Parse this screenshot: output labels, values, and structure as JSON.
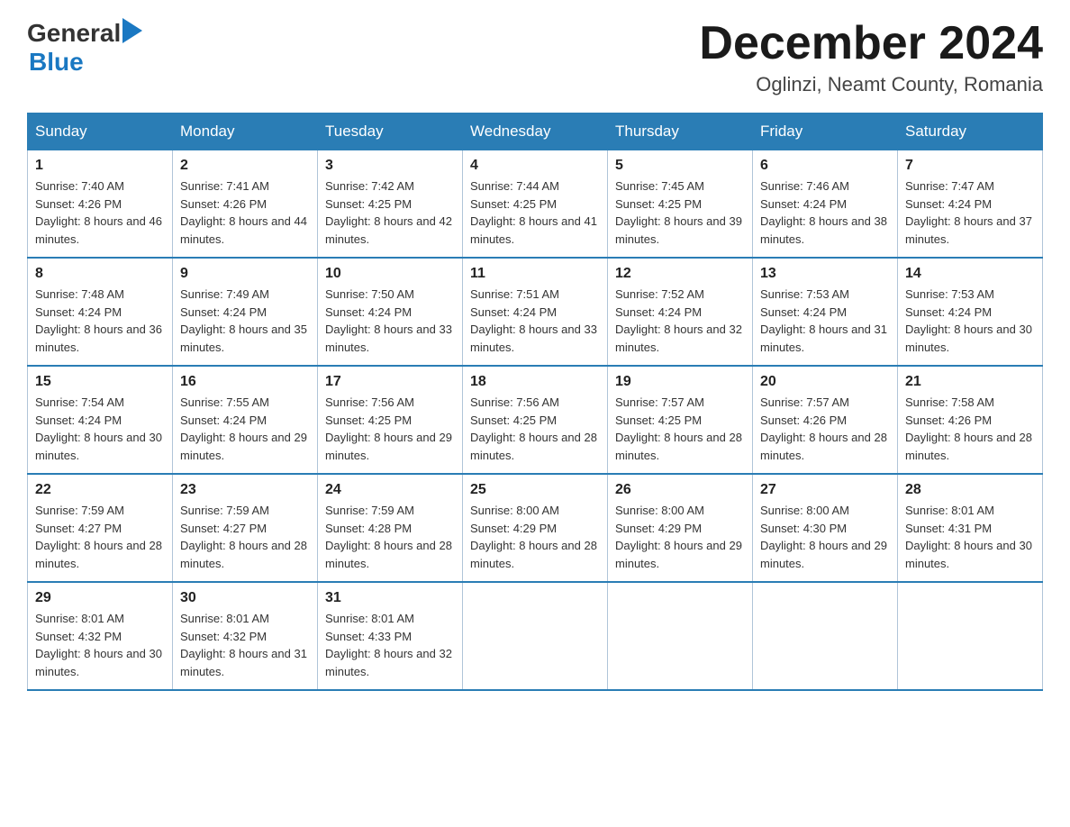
{
  "header": {
    "logo": {
      "general": "General",
      "blue": "Blue"
    },
    "title": "December 2024",
    "location": "Oglinzi, Neamt County, Romania"
  },
  "days_of_week": [
    "Sunday",
    "Monday",
    "Tuesday",
    "Wednesday",
    "Thursday",
    "Friday",
    "Saturday"
  ],
  "weeks": [
    [
      {
        "day": "1",
        "sunrise": "7:40 AM",
        "sunset": "4:26 PM",
        "daylight": "8 hours and 46 minutes."
      },
      {
        "day": "2",
        "sunrise": "7:41 AM",
        "sunset": "4:26 PM",
        "daylight": "8 hours and 44 minutes."
      },
      {
        "day": "3",
        "sunrise": "7:42 AM",
        "sunset": "4:25 PM",
        "daylight": "8 hours and 42 minutes."
      },
      {
        "day": "4",
        "sunrise": "7:44 AM",
        "sunset": "4:25 PM",
        "daylight": "8 hours and 41 minutes."
      },
      {
        "day": "5",
        "sunrise": "7:45 AM",
        "sunset": "4:25 PM",
        "daylight": "8 hours and 39 minutes."
      },
      {
        "day": "6",
        "sunrise": "7:46 AM",
        "sunset": "4:24 PM",
        "daylight": "8 hours and 38 minutes."
      },
      {
        "day": "7",
        "sunrise": "7:47 AM",
        "sunset": "4:24 PM",
        "daylight": "8 hours and 37 minutes."
      }
    ],
    [
      {
        "day": "8",
        "sunrise": "7:48 AM",
        "sunset": "4:24 PM",
        "daylight": "8 hours and 36 minutes."
      },
      {
        "day": "9",
        "sunrise": "7:49 AM",
        "sunset": "4:24 PM",
        "daylight": "8 hours and 35 minutes."
      },
      {
        "day": "10",
        "sunrise": "7:50 AM",
        "sunset": "4:24 PM",
        "daylight": "8 hours and 33 minutes."
      },
      {
        "day": "11",
        "sunrise": "7:51 AM",
        "sunset": "4:24 PM",
        "daylight": "8 hours and 33 minutes."
      },
      {
        "day": "12",
        "sunrise": "7:52 AM",
        "sunset": "4:24 PM",
        "daylight": "8 hours and 32 minutes."
      },
      {
        "day": "13",
        "sunrise": "7:53 AM",
        "sunset": "4:24 PM",
        "daylight": "8 hours and 31 minutes."
      },
      {
        "day": "14",
        "sunrise": "7:53 AM",
        "sunset": "4:24 PM",
        "daylight": "8 hours and 30 minutes."
      }
    ],
    [
      {
        "day": "15",
        "sunrise": "7:54 AM",
        "sunset": "4:24 PM",
        "daylight": "8 hours and 30 minutes."
      },
      {
        "day": "16",
        "sunrise": "7:55 AM",
        "sunset": "4:24 PM",
        "daylight": "8 hours and 29 minutes."
      },
      {
        "day": "17",
        "sunrise": "7:56 AM",
        "sunset": "4:25 PM",
        "daylight": "8 hours and 29 minutes."
      },
      {
        "day": "18",
        "sunrise": "7:56 AM",
        "sunset": "4:25 PM",
        "daylight": "8 hours and 28 minutes."
      },
      {
        "day": "19",
        "sunrise": "7:57 AM",
        "sunset": "4:25 PM",
        "daylight": "8 hours and 28 minutes."
      },
      {
        "day": "20",
        "sunrise": "7:57 AM",
        "sunset": "4:26 PM",
        "daylight": "8 hours and 28 minutes."
      },
      {
        "day": "21",
        "sunrise": "7:58 AM",
        "sunset": "4:26 PM",
        "daylight": "8 hours and 28 minutes."
      }
    ],
    [
      {
        "day": "22",
        "sunrise": "7:59 AM",
        "sunset": "4:27 PM",
        "daylight": "8 hours and 28 minutes."
      },
      {
        "day": "23",
        "sunrise": "7:59 AM",
        "sunset": "4:27 PM",
        "daylight": "8 hours and 28 minutes."
      },
      {
        "day": "24",
        "sunrise": "7:59 AM",
        "sunset": "4:28 PM",
        "daylight": "8 hours and 28 minutes."
      },
      {
        "day": "25",
        "sunrise": "8:00 AM",
        "sunset": "4:29 PM",
        "daylight": "8 hours and 28 minutes."
      },
      {
        "day": "26",
        "sunrise": "8:00 AM",
        "sunset": "4:29 PM",
        "daylight": "8 hours and 29 minutes."
      },
      {
        "day": "27",
        "sunrise": "8:00 AM",
        "sunset": "4:30 PM",
        "daylight": "8 hours and 29 minutes."
      },
      {
        "day": "28",
        "sunrise": "8:01 AM",
        "sunset": "4:31 PM",
        "daylight": "8 hours and 30 minutes."
      }
    ],
    [
      {
        "day": "29",
        "sunrise": "8:01 AM",
        "sunset": "4:32 PM",
        "daylight": "8 hours and 30 minutes."
      },
      {
        "day": "30",
        "sunrise": "8:01 AM",
        "sunset": "4:32 PM",
        "daylight": "8 hours and 31 minutes."
      },
      {
        "day": "31",
        "sunrise": "8:01 AM",
        "sunset": "4:33 PM",
        "daylight": "8 hours and 32 minutes."
      },
      null,
      null,
      null,
      null
    ]
  ],
  "labels": {
    "sunrise": "Sunrise:",
    "sunset": "Sunset:",
    "daylight": "Daylight:"
  }
}
